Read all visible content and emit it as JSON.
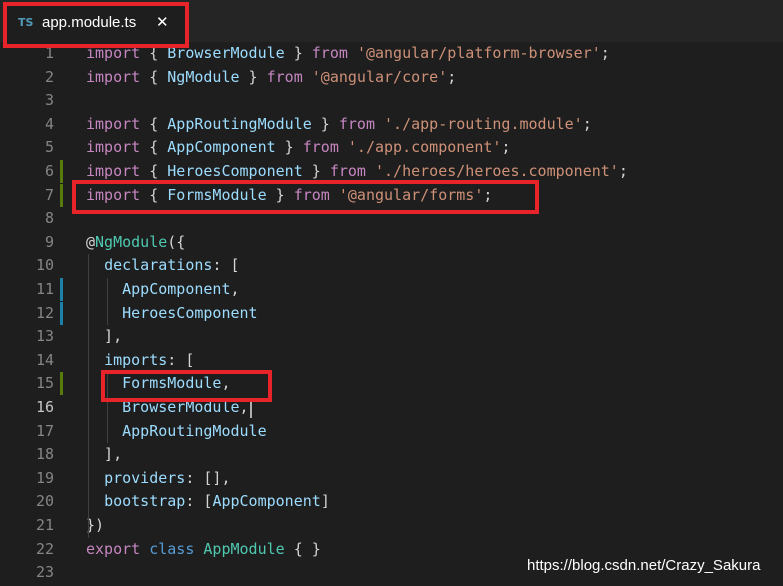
{
  "tab": {
    "icon_label": "TS",
    "filename": "app.module.ts",
    "close_glyph": "✕"
  },
  "watermark": "https://blog.csdn.net/Crazy_Sakura",
  "active_line": 16,
  "colors": {
    "background": "#1e1e1e",
    "keyword": "#569cd6",
    "import_keyword": "#c586c0",
    "identifier": "#9cdcfe",
    "class_name": "#4ec9b0",
    "string": "#ce9178",
    "highlight_box": "#e8242b",
    "git_added": "#587c0c",
    "git_modified": "#1b81a8"
  },
  "lines": [
    {
      "num": "1",
      "tokens": [
        [
          "import",
          "kw2"
        ],
        [
          " { ",
          "pun"
        ],
        [
          "BrowserModule",
          "id"
        ],
        [
          " } ",
          "pun"
        ],
        [
          "from",
          "kw2"
        ],
        [
          " ",
          "pun"
        ],
        [
          "'@angular/platform-browser'",
          "str"
        ],
        [
          ";",
          "pun"
        ]
      ]
    },
    {
      "num": "2",
      "tokens": [
        [
          "import",
          "kw2"
        ],
        [
          " { ",
          "pun"
        ],
        [
          "NgModule",
          "id"
        ],
        [
          " } ",
          "pun"
        ],
        [
          "from",
          "kw2"
        ],
        [
          " ",
          "pun"
        ],
        [
          "'@angular/core'",
          "str"
        ],
        [
          ";",
          "pun"
        ]
      ]
    },
    {
      "num": "3",
      "tokens": []
    },
    {
      "num": "4",
      "tokens": [
        [
          "import",
          "kw2"
        ],
        [
          " { ",
          "pun"
        ],
        [
          "AppRoutingModule",
          "id"
        ],
        [
          " } ",
          "pun"
        ],
        [
          "from",
          "kw2"
        ],
        [
          " ",
          "pun"
        ],
        [
          "'./app-routing.module'",
          "str"
        ],
        [
          ";",
          "pun"
        ]
      ]
    },
    {
      "num": "5",
      "tokens": [
        [
          "import",
          "kw2"
        ],
        [
          " { ",
          "pun"
        ],
        [
          "AppComponent",
          "id"
        ],
        [
          " } ",
          "pun"
        ],
        [
          "from",
          "kw2"
        ],
        [
          " ",
          "pun"
        ],
        [
          "'./app.component'",
          "str"
        ],
        [
          ";",
          "pun"
        ]
      ]
    },
    {
      "num": "6",
      "tokens": [
        [
          "import",
          "kw2"
        ],
        [
          " { ",
          "pun"
        ],
        [
          "HeroesComponent",
          "id"
        ],
        [
          " } ",
          "pun"
        ],
        [
          "from",
          "kw2"
        ],
        [
          " ",
          "pun"
        ],
        [
          "'./heroes/heroes.component'",
          "str"
        ],
        [
          ";",
          "pun"
        ]
      ],
      "git": "added"
    },
    {
      "num": "7",
      "tokens": [
        [
          "import",
          "kw2"
        ],
        [
          " { ",
          "pun"
        ],
        [
          "FormsModule",
          "id"
        ],
        [
          " } ",
          "pun"
        ],
        [
          "from",
          "kw2"
        ],
        [
          " ",
          "pun"
        ],
        [
          "'@angular/forms'",
          "str"
        ],
        [
          ";",
          "pun"
        ]
      ],
      "git": "added"
    },
    {
      "num": "8",
      "tokens": []
    },
    {
      "num": "9",
      "tokens": [
        [
          "@",
          "pun"
        ],
        [
          "NgModule",
          "cls"
        ],
        [
          "({",
          "pun"
        ]
      ]
    },
    {
      "num": "10",
      "tokens": [
        [
          "  ",
          "pun"
        ],
        [
          "declarations",
          "id"
        ],
        [
          ": [",
          "pun"
        ]
      ]
    },
    {
      "num": "11",
      "tokens": [
        [
          "    ",
          "pun"
        ],
        [
          "AppComponent",
          "id"
        ],
        [
          ",",
          "pun"
        ]
      ],
      "git": "modified"
    },
    {
      "num": "12",
      "tokens": [
        [
          "    ",
          "pun"
        ],
        [
          "HeroesComponent",
          "id"
        ]
      ],
      "git": "modified"
    },
    {
      "num": "13",
      "tokens": [
        [
          "  ],",
          "pun"
        ]
      ]
    },
    {
      "num": "14",
      "tokens": [
        [
          "  ",
          "pun"
        ],
        [
          "imports",
          "id"
        ],
        [
          ": [",
          "pun"
        ]
      ]
    },
    {
      "num": "15",
      "tokens": [
        [
          "    ",
          "pun"
        ],
        [
          "FormsModule",
          "id"
        ],
        [
          ",",
          "pun"
        ]
      ],
      "git": "added"
    },
    {
      "num": "16",
      "tokens": [
        [
          "    ",
          "pun"
        ],
        [
          "BrowserModule",
          "id"
        ],
        [
          ",",
          "pun"
        ]
      ]
    },
    {
      "num": "17",
      "tokens": [
        [
          "    ",
          "pun"
        ],
        [
          "AppRoutingModule",
          "id"
        ]
      ]
    },
    {
      "num": "18",
      "tokens": [
        [
          "  ],",
          "pun"
        ]
      ]
    },
    {
      "num": "19",
      "tokens": [
        [
          "  ",
          "pun"
        ],
        [
          "providers",
          "id"
        ],
        [
          ": [],",
          "pun"
        ]
      ]
    },
    {
      "num": "20",
      "tokens": [
        [
          "  ",
          "pun"
        ],
        [
          "bootstrap",
          "id"
        ],
        [
          ": [",
          "pun"
        ],
        [
          "AppComponent",
          "id"
        ],
        [
          "]",
          "pun"
        ]
      ]
    },
    {
      "num": "21",
      "tokens": [
        [
          "})",
          "pun"
        ]
      ]
    },
    {
      "num": "22",
      "tokens": [
        [
          "export",
          "kw2"
        ],
        [
          " ",
          "pun"
        ],
        [
          "class",
          "kw"
        ],
        [
          " ",
          "pun"
        ],
        [
          "AppModule",
          "cls"
        ],
        [
          " { }",
          "pun"
        ]
      ]
    },
    {
      "num": "23",
      "tokens": []
    }
  ]
}
